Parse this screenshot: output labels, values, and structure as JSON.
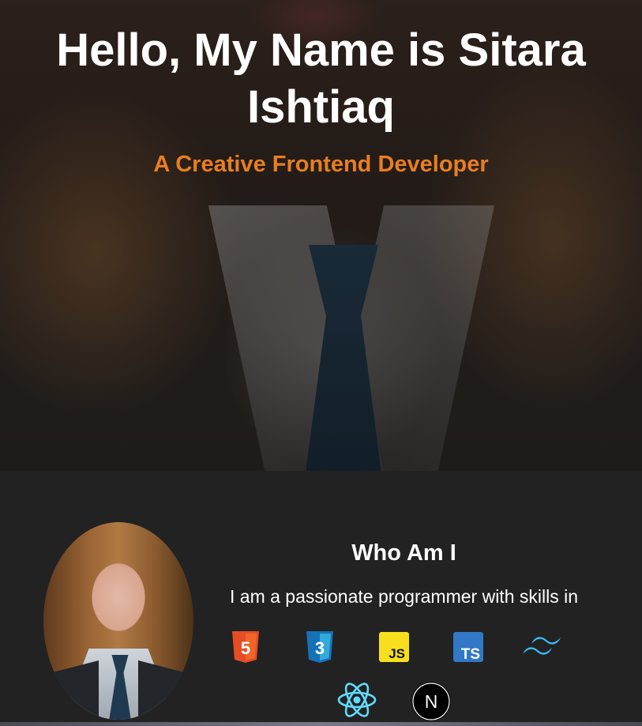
{
  "hero": {
    "title": "Hello, My Name is Sitara Ishtiaq",
    "subtitle": "A Creative Frontend Developer"
  },
  "about": {
    "title": "Who Am I",
    "text": "I am a passionate programmer with skills in",
    "skills": [
      {
        "icon": "html5-icon",
        "label": "5"
      },
      {
        "icon": "css3-icon",
        "label": "3"
      },
      {
        "icon": "javascript-icon",
        "label": "JS"
      },
      {
        "icon": "typescript-icon",
        "label": "TS"
      },
      {
        "icon": "tailwind-icon"
      },
      {
        "icon": "react-icon"
      },
      {
        "icon": "nextjs-icon",
        "label": "N"
      }
    ]
  },
  "colors": {
    "accent": "#e87e22",
    "background": "#222222",
    "html5": "#e44d26",
    "css3": "#1572b6",
    "javascript": "#f7df1e",
    "typescript": "#3178c6",
    "tailwind": "#38bdf8",
    "react": "#61dafb",
    "nextjs": "#000000"
  }
}
